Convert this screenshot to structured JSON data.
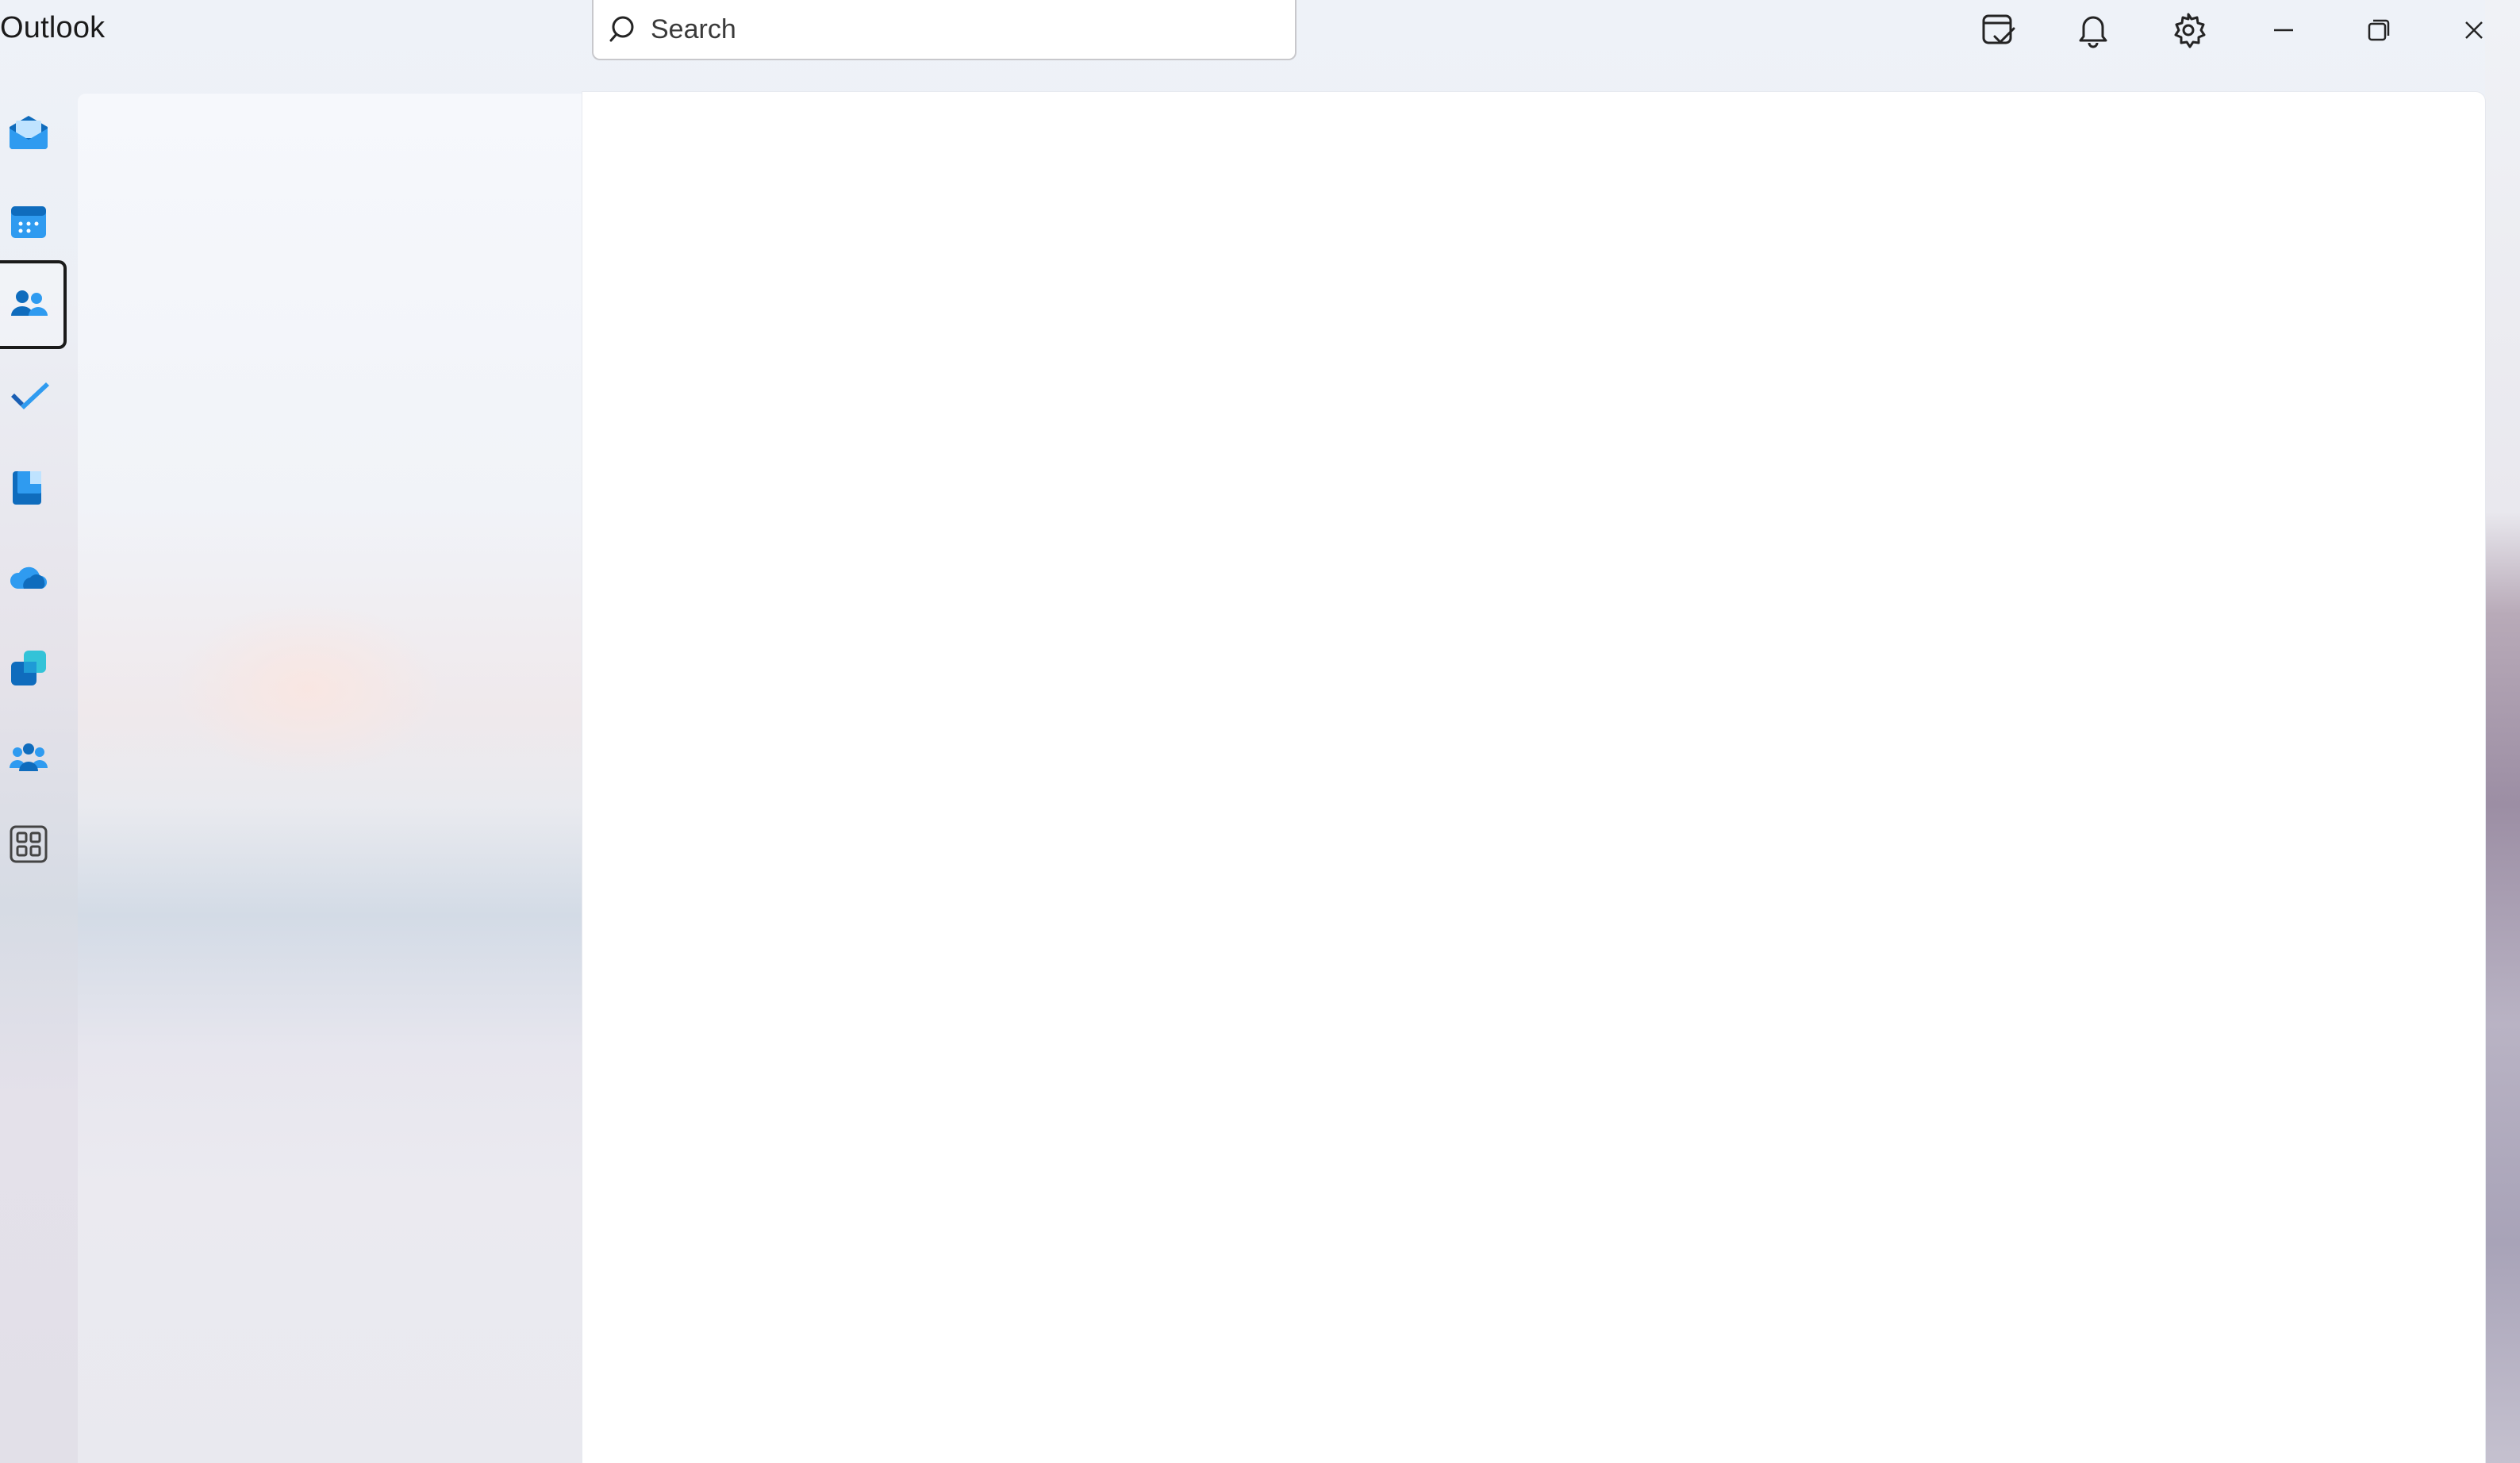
{
  "window": {
    "title": "Outlook"
  },
  "search": {
    "placeholder": "Search",
    "value": ""
  },
  "titlebar_actions": [
    {
      "name": "my-day",
      "icon": "calendar-check-icon"
    },
    {
      "name": "notifications",
      "icon": "bell-icon"
    },
    {
      "name": "settings",
      "icon": "gear-icon"
    },
    {
      "name": "minimize",
      "icon": "minimize-icon"
    },
    {
      "name": "restore",
      "icon": "restore-icon"
    },
    {
      "name": "close",
      "icon": "close-icon"
    }
  ],
  "rail": {
    "items": [
      {
        "name": "mail",
        "icon": "mail-icon",
        "selected": false
      },
      {
        "name": "calendar",
        "icon": "calendar-icon",
        "selected": false
      },
      {
        "name": "people",
        "icon": "people-icon",
        "selected": true
      },
      {
        "name": "to-do",
        "icon": "todo-check-icon",
        "selected": false
      },
      {
        "name": "files",
        "icon": "files-icon",
        "selected": false
      },
      {
        "name": "onedrive",
        "icon": "onedrive-cloud-icon",
        "selected": false
      },
      {
        "name": "bookings",
        "icon": "bookings-icon",
        "selected": false
      },
      {
        "name": "groups",
        "icon": "groups-icon",
        "selected": false
      },
      {
        "name": "more-apps",
        "icon": "apps-grid-icon",
        "selected": false
      }
    ]
  },
  "colors": {
    "accent": "#0f6cbd",
    "accent_light": "#2f9bf0",
    "text": "#1b1b1b",
    "main_bg": "#ffffff"
  }
}
